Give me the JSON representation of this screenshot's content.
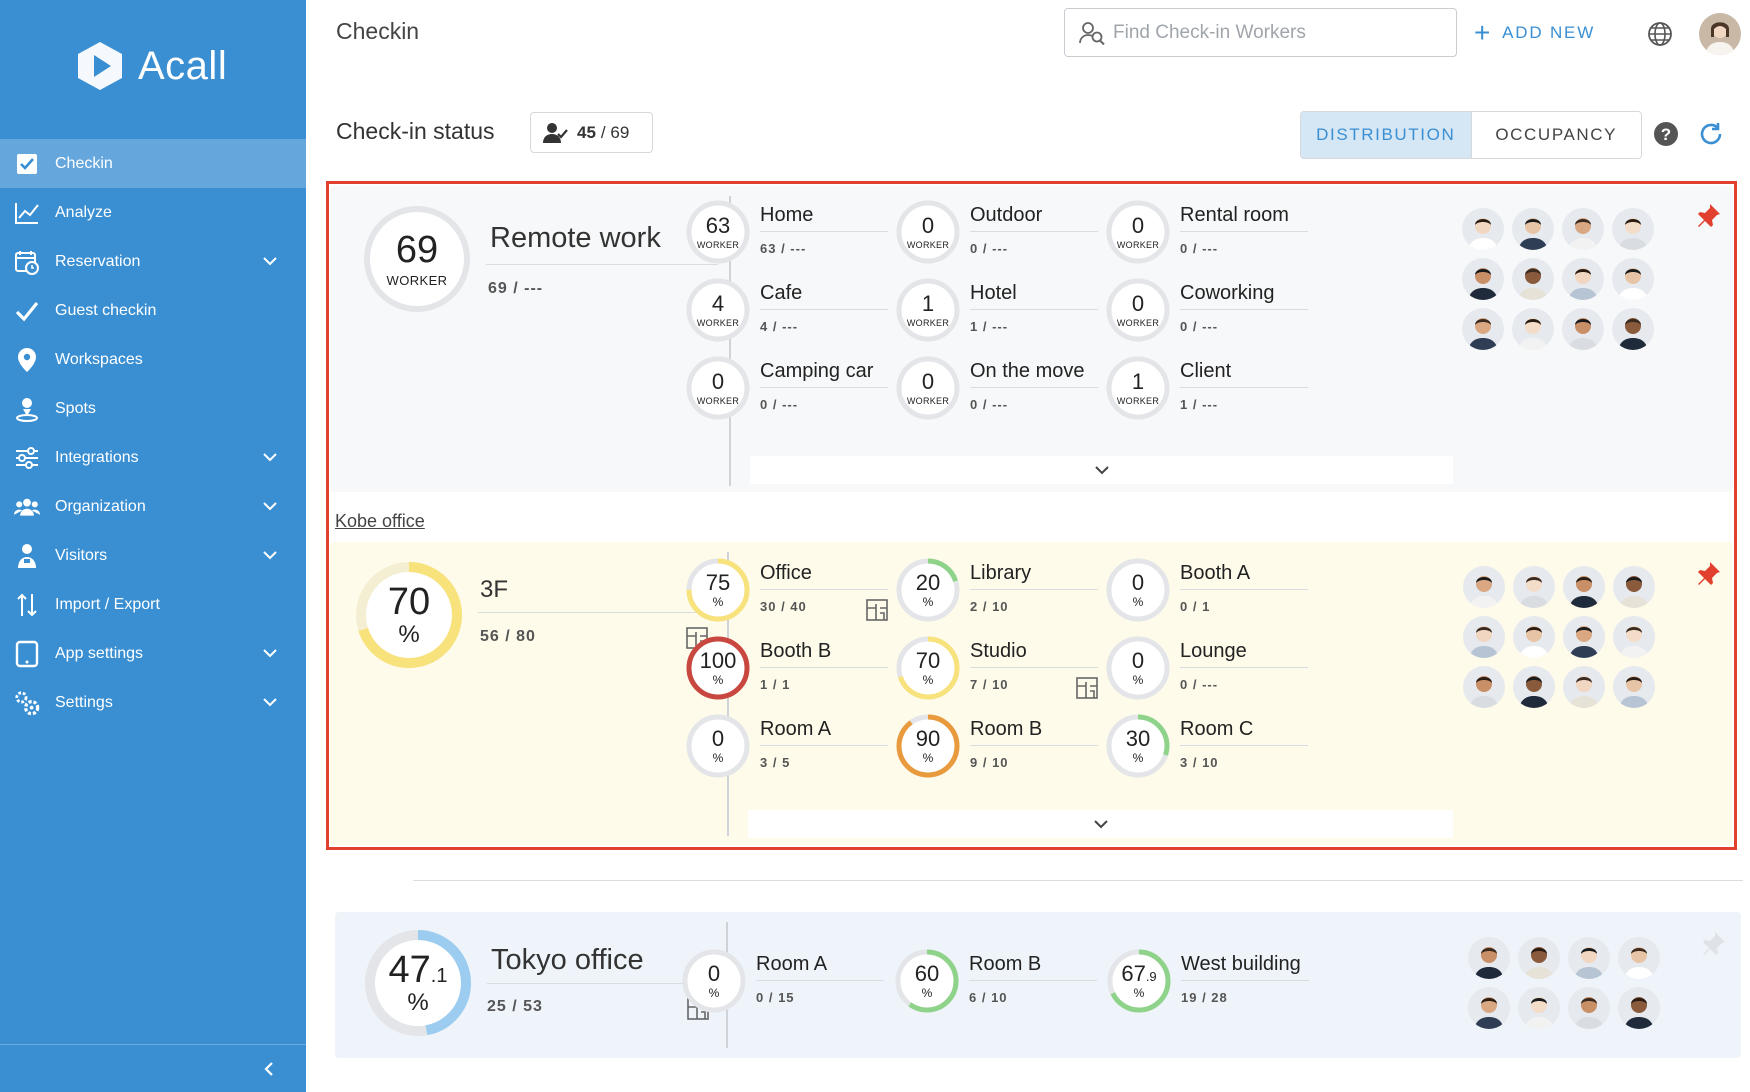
{
  "sidebar": {
    "brand": "Acall",
    "items": [
      {
        "label": "Checkin",
        "icon": "checkbox-icon",
        "active": true,
        "expandable": false
      },
      {
        "label": "Analyze",
        "icon": "chart-line-icon",
        "active": false,
        "expandable": false
      },
      {
        "label": "Reservation",
        "icon": "calendar-clock-icon",
        "active": false,
        "expandable": true
      },
      {
        "label": "Guest checkin",
        "icon": "checkmark-icon",
        "active": false,
        "expandable": false
      },
      {
        "label": "Workspaces",
        "icon": "location-pin-icon",
        "active": false,
        "expandable": false
      },
      {
        "label": "Spots",
        "icon": "person-pin-icon",
        "active": false,
        "expandable": false
      },
      {
        "label": "Integrations",
        "icon": "sliders-icon",
        "active": false,
        "expandable": true
      },
      {
        "label": "Organization",
        "icon": "people-icon",
        "active": false,
        "expandable": true
      },
      {
        "label": "Visitors",
        "icon": "visitor-icon",
        "active": false,
        "expandable": true
      },
      {
        "label": "Import / Export",
        "icon": "arrows-updown-icon",
        "active": false,
        "expandable": false
      },
      {
        "label": "App settings",
        "icon": "tablet-icon",
        "active": false,
        "expandable": true
      },
      {
        "label": "Settings",
        "icon": "gears-icon",
        "active": false,
        "expandable": true
      }
    ]
  },
  "header": {
    "title": "Checkin",
    "search_placeholder": "Find Check-in Workers",
    "add_new": "ADD NEW"
  },
  "status": {
    "label": "Check-in status",
    "checked": "45",
    "total": "/ 69",
    "tabs": [
      "DISTRIBUTION",
      "OCCUPANCY"
    ],
    "active_tab": "DISTRIBUTION"
  },
  "colors": {
    "sidebar": "#3a8fd3",
    "accent": "#3a8fd3",
    "highlight_frame": "#e2402e",
    "ring_track": "#e3e5e8",
    "ring_yellow": "#f8e27c",
    "ring_green": "#8fd38a",
    "ring_orange": "#e89a3c",
    "ring_red": "#c8473f",
    "ring_blue": "#9ccdf0",
    "pin": "#e2402e"
  },
  "remote": {
    "value": "69",
    "unit": "WORKER",
    "name": "Remote work",
    "ratio": "69 / ---",
    "pinned": true,
    "spots": [
      {
        "name": "Home",
        "value": "63",
        "unit": "WORKER",
        "ratio": "63 / ---"
      },
      {
        "name": "Outdoor",
        "value": "0",
        "unit": "WORKER",
        "ratio": "0 / ---"
      },
      {
        "name": "Rental room",
        "value": "0",
        "unit": "WORKER",
        "ratio": "0 / ---"
      },
      {
        "name": "Cafe",
        "value": "4",
        "unit": "WORKER",
        "ratio": "4 / ---"
      },
      {
        "name": "Hotel",
        "value": "1",
        "unit": "WORKER",
        "ratio": "1 / ---"
      },
      {
        "name": "Coworking",
        "value": "0",
        "unit": "WORKER",
        "ratio": "0 / ---"
      },
      {
        "name": "Camping car",
        "value": "0",
        "unit": "WORKER",
        "ratio": "0 / ---"
      },
      {
        "name": "On the move",
        "value": "0",
        "unit": "WORKER",
        "ratio": "0 / ---"
      },
      {
        "name": "Client",
        "value": "1",
        "unit": "WORKER",
        "ratio": "1 / ---"
      }
    ]
  },
  "kobe": {
    "link": "Kobe office",
    "value": "70",
    "unit": "%",
    "name": "3F",
    "ratio": "56 / 80",
    "occupancy": 0.7,
    "pinned": true,
    "spots": [
      {
        "name": "Office",
        "value": "75",
        "unit": "%",
        "ratio": "30 / 40",
        "occupancy": 0.75,
        "color": "yellow",
        "floor_map": true
      },
      {
        "name": "Library",
        "value": "20",
        "unit": "%",
        "ratio": "2 / 10",
        "occupancy": 0.2,
        "color": "green",
        "floor_map": false
      },
      {
        "name": "Booth A",
        "value": "0",
        "unit": "%",
        "ratio": "0 / 1",
        "occupancy": 0,
        "color": "green",
        "floor_map": false
      },
      {
        "name": "Booth B",
        "value": "100",
        "unit": "%",
        "ratio": "1 / 1",
        "occupancy": 1.0,
        "color": "red",
        "floor_map": false
      },
      {
        "name": "Studio",
        "value": "70",
        "unit": "%",
        "ratio": "7 / 10",
        "occupancy": 0.7,
        "color": "yellow",
        "floor_map": true
      },
      {
        "name": "Lounge",
        "value": "0",
        "unit": "%",
        "ratio": "0 / ---",
        "occupancy": 0,
        "color": "green",
        "floor_map": false
      },
      {
        "name": "Room A",
        "value": "0",
        "unit": "%",
        "ratio": "3 / 5",
        "occupancy": 0,
        "color": "green",
        "floor_map": false
      },
      {
        "name": "Room B",
        "value": "90",
        "unit": "%",
        "ratio": "9 / 10",
        "occupancy": 0.9,
        "color": "orange",
        "floor_map": false
      },
      {
        "name": "Room C",
        "value": "30",
        "unit": "%",
        "ratio": "3 / 10",
        "occupancy": 0.3,
        "color": "green",
        "floor_map": false
      }
    ]
  },
  "tokyo": {
    "value": "47",
    "decimal": ".1",
    "unit": "%",
    "name": "Tokyo office",
    "ratio": "25 / 53",
    "occupancy": 0.471,
    "pinned": false,
    "spots": [
      {
        "name": "Room A",
        "value": "0",
        "decimal": "",
        "unit": "%",
        "ratio": "0 / 15",
        "occupancy": 0,
        "color": "green"
      },
      {
        "name": "Room B",
        "value": "60",
        "decimal": "",
        "unit": "%",
        "ratio": "6 / 10",
        "occupancy": 0.6,
        "color": "green"
      },
      {
        "name": "West building",
        "value": "67",
        "decimal": ".9",
        "unit": "%",
        "ratio": "19 / 28",
        "occupancy": 0.679,
        "color": "green"
      }
    ]
  }
}
